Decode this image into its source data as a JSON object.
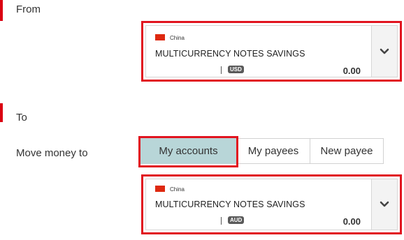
{
  "from": {
    "heading": "From",
    "account": {
      "country": "China",
      "name": "MULTICURRENCY NOTES SAVINGS",
      "currency": "USD",
      "balance": "0.00",
      "flag_color": "#de2910"
    }
  },
  "to": {
    "heading": "To",
    "move_money_label": "Move money to",
    "tabs": [
      {
        "label": "My accounts",
        "selected": true
      },
      {
        "label": "My payees",
        "selected": false
      },
      {
        "label": "New payee",
        "selected": false
      }
    ],
    "account": {
      "country": "China",
      "name": "MULTICURRENCY NOTES SAVINGS",
      "currency": "AUD",
      "balance": "0.00",
      "flag_color": "#de2910"
    }
  },
  "colors": {
    "accent_red": "#db0011",
    "highlight_red": "#e1141f",
    "selected_tab": "#b8d6d8"
  },
  "icons": {
    "dropdown": "chevron-down-icon",
    "flag": "china-flag-icon"
  }
}
